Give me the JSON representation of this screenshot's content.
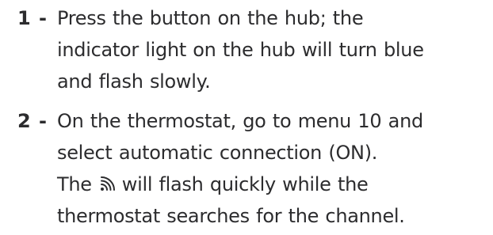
{
  "steps": [
    {
      "number": "1 -",
      "lines": [
        "Press the button on the hub; the",
        "indicator light on the hub will turn blue",
        "and flash slowly."
      ]
    },
    {
      "number": "2 -",
      "lines": [
        "On the thermostat, go to menu 10 and",
        "select automatic connection (ON).",
        "The",
        "will flash quickly while the",
        "thermostat searches for the channel."
      ],
      "inline_icon": "wireless-signal-icon"
    }
  ],
  "colors": {
    "text": "#2c2c2e"
  }
}
